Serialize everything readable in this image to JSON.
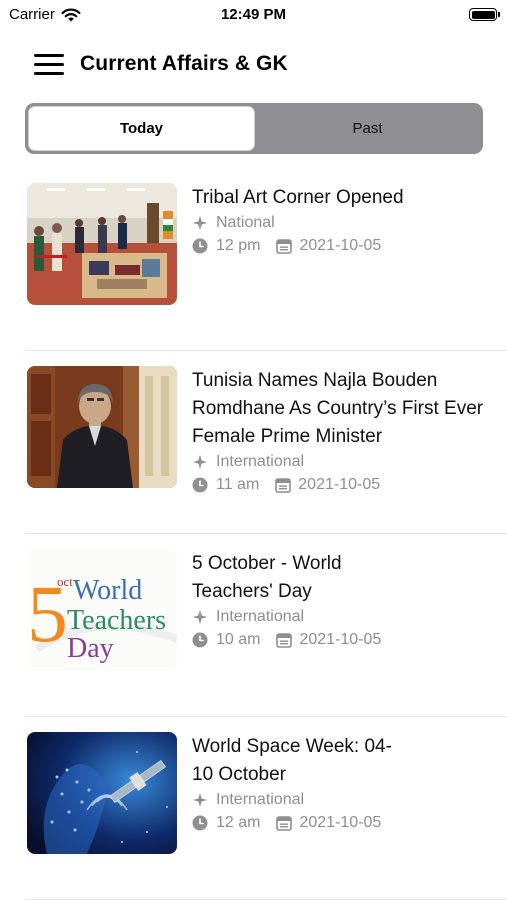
{
  "status_bar": {
    "carrier": "Carrier",
    "time": "12:49 PM"
  },
  "nav": {
    "title": "Current Affairs & GK",
    "menu_icon": "hamburger-menu-icon"
  },
  "segments": [
    {
      "label": "Today",
      "selected": true
    },
    {
      "label": "Past",
      "selected": false
    }
  ],
  "colors": {
    "segment_bg": "#8e8e93",
    "meta_text": "#8e8e93",
    "divider": "#e6e6e6"
  },
  "news": [
    {
      "title": "Tribal Art Corner Opened",
      "category": "National",
      "time": "12 pm",
      "date": "2021-10-05",
      "thumb": "tribal-art-exhibition-photo"
    },
    {
      "title": "Tunisia Names Najla Bouden Romdhane As Country’s First Ever Female Prime Minister",
      "category": "International",
      "time": "11 am",
      "date": "2021-10-05",
      "thumb": "najla-bouden-portrait-photo"
    },
    {
      "title": "5 October - World Teachers' Day",
      "category": "International",
      "time": "10 am",
      "date": "2021-10-05",
      "thumb": "world-teachers-day-graphic",
      "thumb_text": {
        "num": "5",
        "sup": "oct",
        "l1": "World",
        "l2": "Teachers",
        "l3": "Day"
      }
    },
    {
      "title": "World Space Week: 04-10 October",
      "category": "International",
      "time": "12 am",
      "date": "2021-10-05",
      "thumb": "space-satellite-graphic"
    }
  ]
}
